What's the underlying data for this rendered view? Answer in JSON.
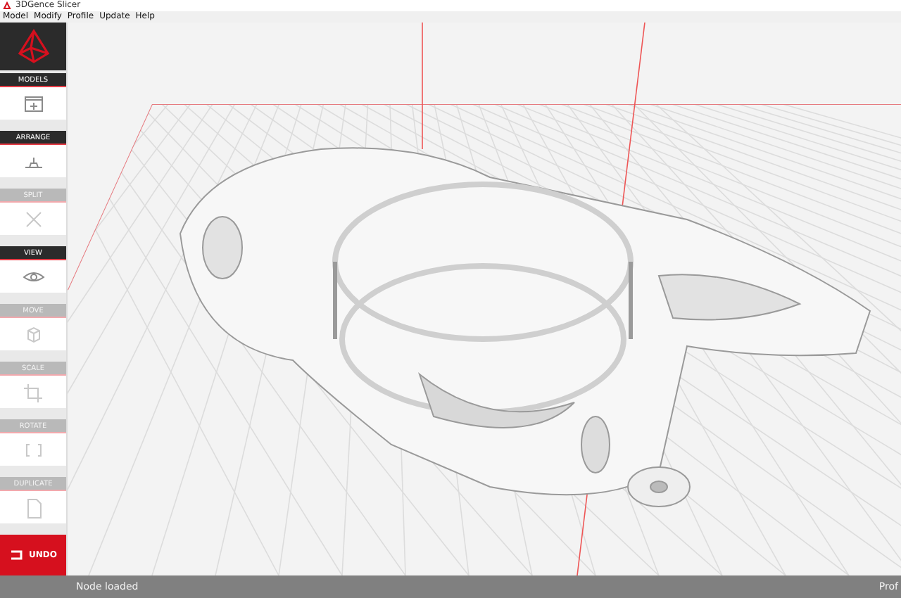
{
  "window": {
    "title": "3DGence Slicer"
  },
  "menu": [
    "Model",
    "Modify",
    "Profile",
    "Update",
    "Help"
  ],
  "tools": [
    {
      "label": "MODELS",
      "kind": "add",
      "disabled": false
    },
    {
      "label": "ARRANGE",
      "kind": "arrange",
      "disabled": false
    },
    {
      "label": "SPLIT",
      "kind": "split",
      "disabled": true
    },
    {
      "label": "VIEW",
      "kind": "view",
      "disabled": false
    },
    {
      "label": "MOVE",
      "kind": "move",
      "disabled": true
    },
    {
      "label": "SCALE",
      "kind": "scale",
      "disabled": true
    },
    {
      "label": "ROTATE",
      "kind": "rotate",
      "disabled": true
    },
    {
      "label": "DUPLICATE",
      "kind": "duplicate",
      "disabled": true
    }
  ],
  "undo": {
    "label": "UNDO"
  },
  "status_bar": {
    "message": "Node loaded",
    "right": "Prof"
  }
}
